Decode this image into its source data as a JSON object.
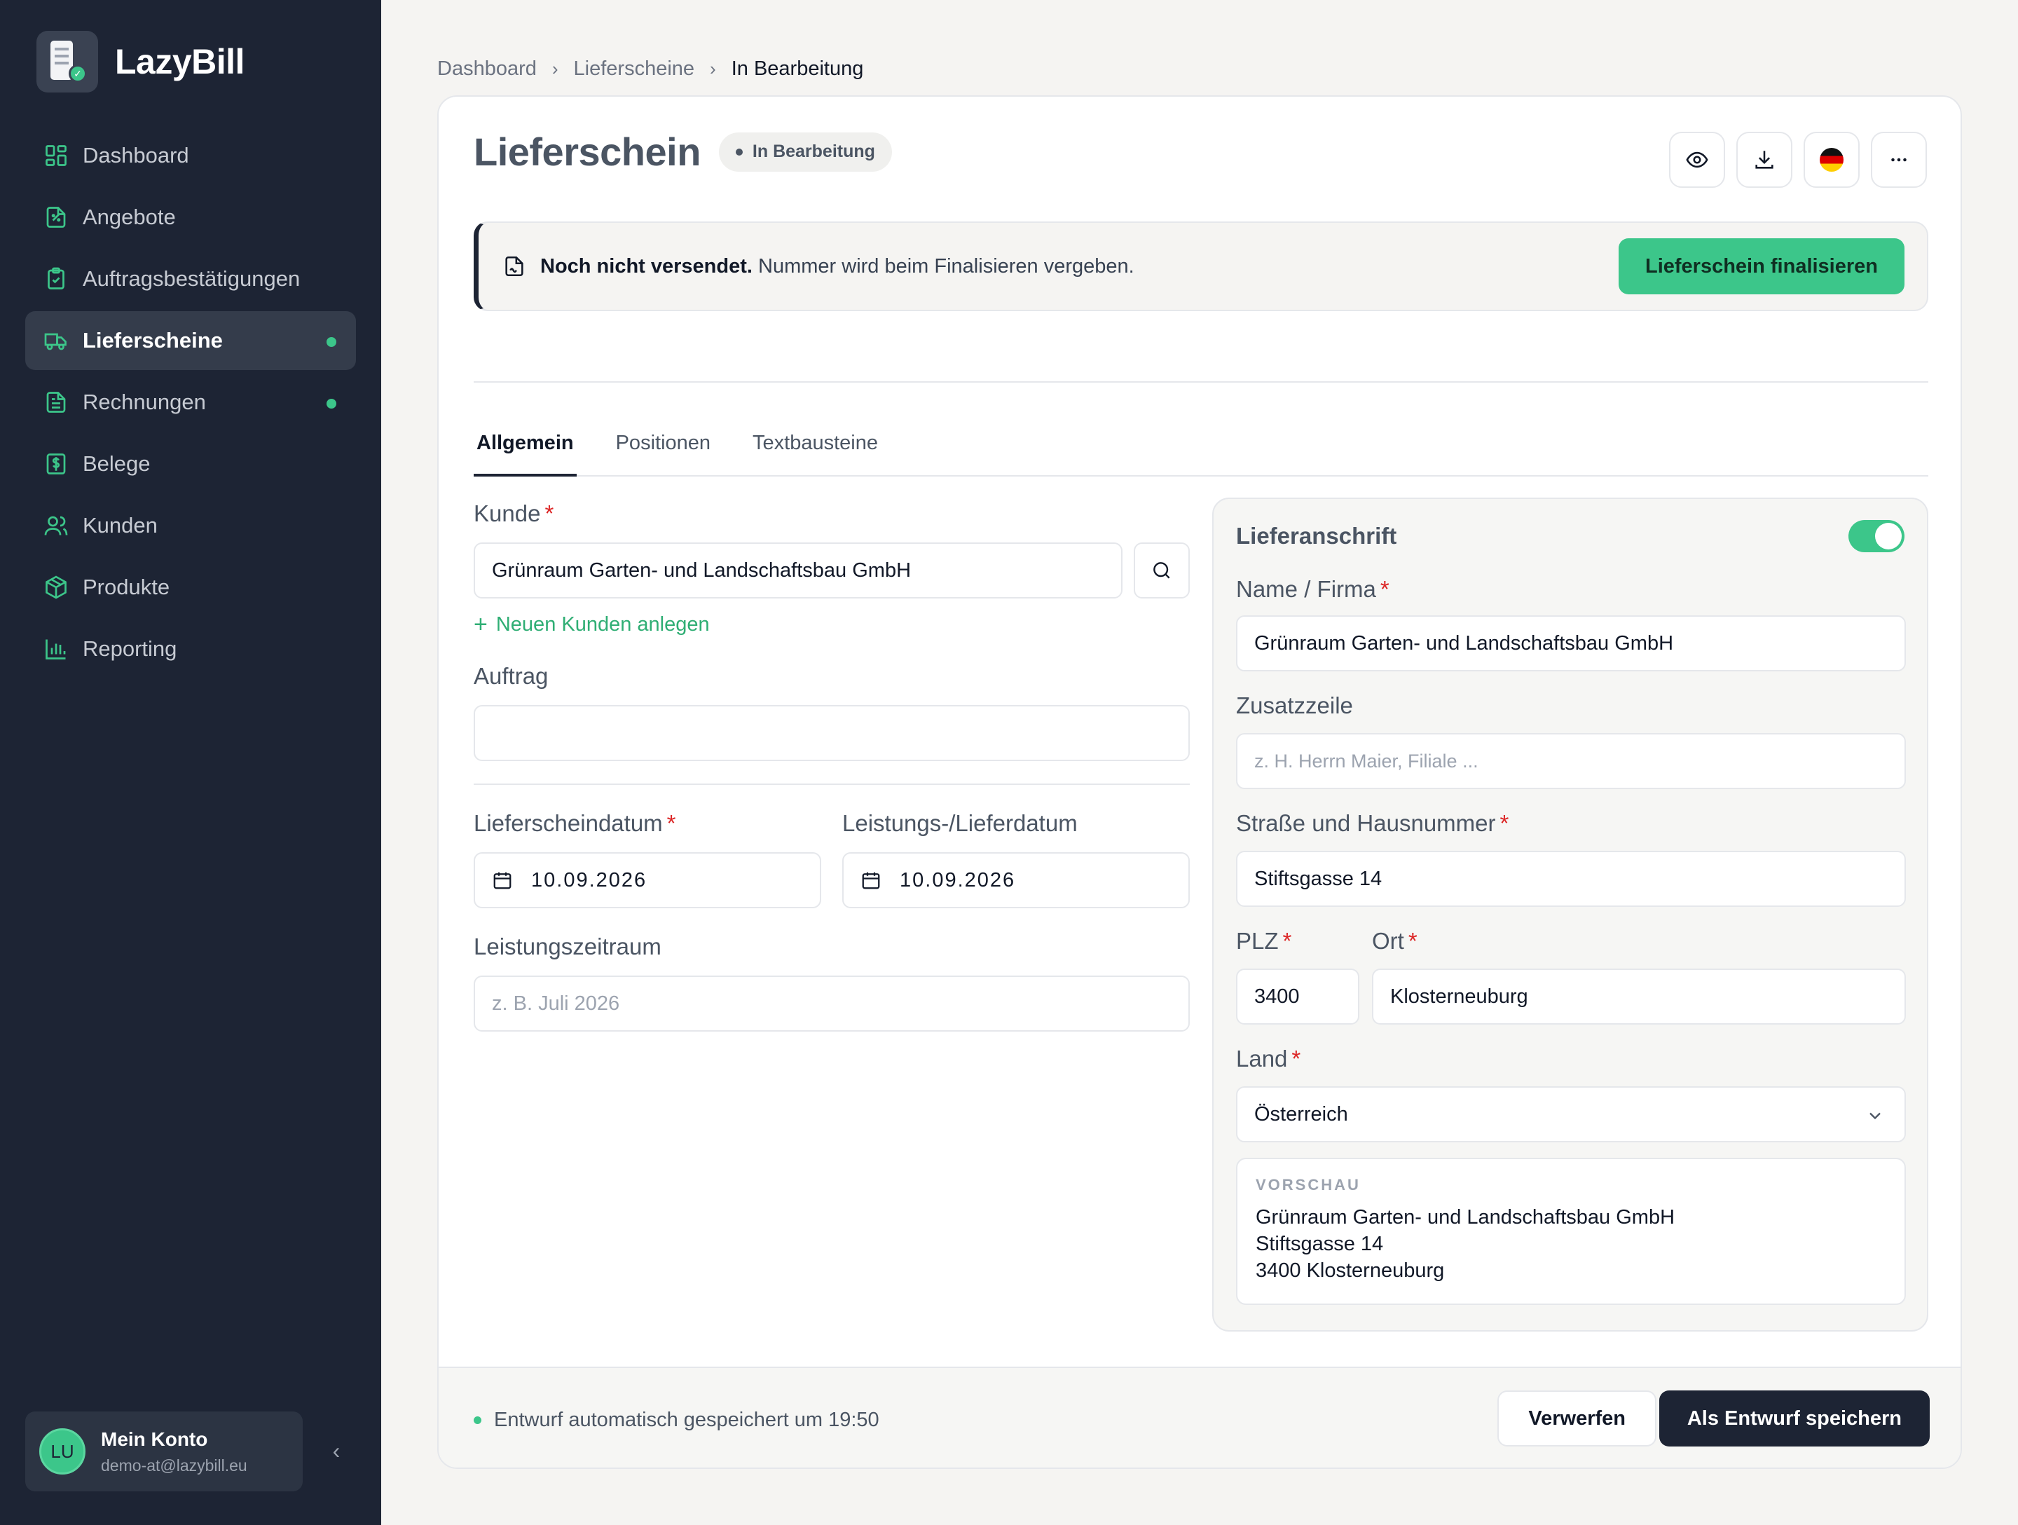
{
  "app": {
    "name": "LazyBill"
  },
  "sidebar": {
    "items": [
      {
        "label": "Dashboard",
        "icon": "dashboard-icon",
        "active": false,
        "dot": false
      },
      {
        "label": "Angebote",
        "icon": "offer-icon",
        "active": false,
        "dot": false
      },
      {
        "label": "Auftragsbestätigungen",
        "icon": "clipboard-check-icon",
        "active": false,
        "dot": false
      },
      {
        "label": "Lieferscheine",
        "icon": "truck-icon",
        "active": true,
        "dot": true
      },
      {
        "label": "Rechnungen",
        "icon": "invoice-icon",
        "active": false,
        "dot": true
      },
      {
        "label": "Belege",
        "icon": "receipt-icon",
        "active": false,
        "dot": false
      },
      {
        "label": "Kunden",
        "icon": "users-icon",
        "active": false,
        "dot": false
      },
      {
        "label": "Produkte",
        "icon": "package-icon",
        "active": false,
        "dot": false
      },
      {
        "label": "Reporting",
        "icon": "bar-chart-icon",
        "active": false,
        "dot": false
      }
    ],
    "account": {
      "initials": "LU",
      "name": "Mein Konto",
      "email": "demo-at@lazybill.eu"
    }
  },
  "breadcrumb": [
    "Dashboard",
    "Lieferscheine",
    "In Bearbeitung"
  ],
  "header": {
    "title": "Lieferschein",
    "status": "In Bearbeitung"
  },
  "notice": {
    "bold": "Noch nicht versendet.",
    "text": " Nummer wird beim Finalisieren vergeben.",
    "button": "Lieferschein finalisieren"
  },
  "tabs": [
    "Allgemein",
    "Positionen",
    "Textbausteine"
  ],
  "form": {
    "kunde": {
      "label": "Kunde",
      "value": "Grünraum Garten- und Landschaftsbau GmbH"
    },
    "new_customer": "Neuen Kunden anlegen",
    "auftrag": {
      "label": "Auftrag",
      "value": ""
    },
    "lieferscheindatum": {
      "label": "Lieferscheindatum",
      "value": "10.09.2026"
    },
    "lieferdatum": {
      "label": "Leistungs-/Lieferdatum",
      "value": "10.09.2026"
    },
    "leistungszeitraum": {
      "label": "Leistungszeitraum",
      "placeholder": "z. B. Juli 2026"
    }
  },
  "address": {
    "title": "Lieferanschrift",
    "enabled": true,
    "name": {
      "label": "Name / Firma",
      "value": "Grünraum Garten- und Landschaftsbau GmbH"
    },
    "zusatz": {
      "label": "Zusatzzeile",
      "placeholder": "z. H. Herrn Maier, Filiale ..."
    },
    "strasse": {
      "label": "Straße und Hausnummer",
      "value": "Stiftsgasse 14"
    },
    "plz": {
      "label": "PLZ",
      "value": "3400"
    },
    "ort": {
      "label": "Ort",
      "value": "Klosterneuburg"
    },
    "land": {
      "label": "Land",
      "value": "Österreich"
    },
    "preview": {
      "title": "VORSCHAU",
      "lines": [
        "Grünraum Garten- und Landschaftsbau GmbH",
        "Stiftsgasse 14",
        "3400 Klosterneuburg"
      ]
    }
  },
  "footer": {
    "autosave": "Entwurf automatisch gespeichert um 19:50",
    "discard": "Verwerfen",
    "save": "Als Entwurf speichern"
  },
  "colors": {
    "sidebar": "#1d2434",
    "accent": "#3cc68a",
    "required": "#dc2626"
  }
}
